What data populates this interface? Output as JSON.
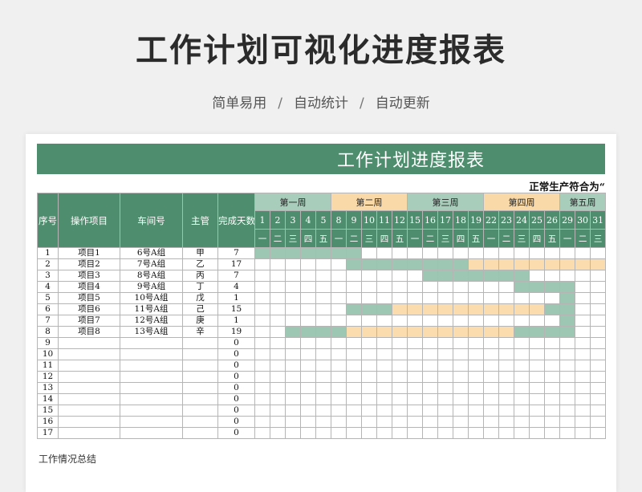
{
  "header": {
    "title": "工作计划可视化进度报表",
    "features": [
      "简单易用",
      "自动统计",
      "自动更新"
    ],
    "separator": "/"
  },
  "sheet": {
    "banner_title": "工作计划进度报表",
    "note": "正常生产符合为“",
    "footer": "工作情况总结"
  },
  "table": {
    "columns": {
      "index": "序号",
      "task": "操作项目",
      "workshop": "车间号",
      "manager": "主管",
      "days": "完成天数"
    },
    "weeks": [
      {
        "label": "第一周",
        "span": 5,
        "color": "#a8cdbb"
      },
      {
        "label": "第二周",
        "span": 5,
        "color": "#fad9a8"
      },
      {
        "label": "第三周",
        "span": 5,
        "color": "#a8cdbb"
      },
      {
        "label": "第四周",
        "span": 5,
        "color": "#fad9a8"
      },
      {
        "label": "第五周",
        "span": 3,
        "color": "#a8cdbb"
      }
    ],
    "dates": [
      1,
      2,
      3,
      4,
      5,
      8,
      9,
      10,
      11,
      12,
      15,
      16,
      17,
      18,
      19,
      22,
      23,
      24,
      25,
      26,
      29,
      30,
      31
    ],
    "weekdays": [
      "一",
      "二",
      "三",
      "四",
      "五",
      "一",
      "二",
      "三",
      "四",
      "五",
      "一",
      "二",
      "三",
      "四",
      "五",
      "一",
      "二",
      "三",
      "四",
      "五",
      "一",
      "二",
      "三"
    ],
    "rows": [
      {
        "index": "1",
        "task": "项目1",
        "workshop": "6号A组",
        "manager": "甲",
        "days": "7",
        "bars": [
          {
            "from": 0,
            "to": 6,
            "color": "green"
          }
        ]
      },
      {
        "index": "2",
        "task": "项目2",
        "workshop": "7号A组",
        "manager": "乙",
        "days": "17",
        "bars": [
          {
            "from": 6,
            "to": 13,
            "color": "green"
          },
          {
            "from": 14,
            "to": 22,
            "color": "orange"
          }
        ]
      },
      {
        "index": "3",
        "task": "项目3",
        "workshop": "8号A组",
        "manager": "丙",
        "days": "7",
        "bars": [
          {
            "from": 11,
            "to": 17,
            "color": "green"
          }
        ]
      },
      {
        "index": "4",
        "task": "项目4",
        "workshop": "9号A组",
        "manager": "丁",
        "days": "4",
        "bars": [
          {
            "from": 17,
            "to": 20,
            "color": "green"
          }
        ]
      },
      {
        "index": "5",
        "task": "项目5",
        "workshop": "10号A组",
        "manager": "戊",
        "days": "1",
        "bars": [
          {
            "from": 20,
            "to": 20,
            "color": "green"
          }
        ]
      },
      {
        "index": "6",
        "task": "项目6",
        "workshop": "11号A组",
        "manager": "己",
        "days": "15",
        "bars": [
          {
            "from": 6,
            "to": 8,
            "color": "green"
          },
          {
            "from": 9,
            "to": 18,
            "color": "orange"
          },
          {
            "from": 19,
            "to": 20,
            "color": "green"
          }
        ]
      },
      {
        "index": "7",
        "task": "项目7",
        "workshop": "12号A组",
        "manager": "庚",
        "days": "1",
        "bars": [
          {
            "from": 20,
            "to": 20,
            "color": "green"
          }
        ]
      },
      {
        "index": "8",
        "task": "项目8",
        "workshop": "13号A组",
        "manager": "辛",
        "days": "19",
        "bars": [
          {
            "from": 2,
            "to": 5,
            "color": "green"
          },
          {
            "from": 6,
            "to": 16,
            "color": "orange"
          },
          {
            "from": 17,
            "to": 20,
            "color": "green"
          }
        ]
      },
      {
        "index": "9",
        "task": "",
        "workshop": "",
        "manager": "",
        "days": "0",
        "bars": []
      },
      {
        "index": "10",
        "task": "",
        "workshop": "",
        "manager": "",
        "days": "0",
        "bars": []
      },
      {
        "index": "11",
        "task": "",
        "workshop": "",
        "manager": "",
        "days": "0",
        "bars": []
      },
      {
        "index": "12",
        "task": "",
        "workshop": "",
        "manager": "",
        "days": "0",
        "bars": []
      },
      {
        "index": "13",
        "task": "",
        "workshop": "",
        "manager": "",
        "days": "0",
        "bars": []
      },
      {
        "index": "14",
        "task": "",
        "workshop": "",
        "manager": "",
        "days": "0",
        "bars": []
      },
      {
        "index": "15",
        "task": "",
        "workshop": "",
        "manager": "",
        "days": "0",
        "bars": []
      },
      {
        "index": "16",
        "task": "",
        "workshop": "",
        "manager": "",
        "days": "0",
        "bars": []
      },
      {
        "index": "17",
        "task": "",
        "workshop": "",
        "manager": "",
        "days": "0",
        "bars": []
      }
    ]
  }
}
